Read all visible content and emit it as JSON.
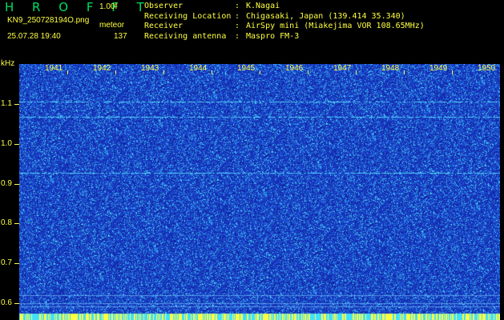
{
  "header": {
    "logo": "H R O F F T",
    "version": "1.00f",
    "filename": "KN9_250728194O.png",
    "meteor_tag": "meteor",
    "datetime": "25.07.28 19:40",
    "count": "137"
  },
  "metadata": [
    {
      "key": "Observer",
      "sep": ":",
      "value": "K.Nagai"
    },
    {
      "key": "Receiving Location",
      "sep": ":",
      "value": "Chigasaki, Japan (139.414 35.340)"
    },
    {
      "key": "Receiver",
      "sep": ":",
      "value": "AirSpy mini (Miakejima VOR 108.65MHz)"
    },
    {
      "key": "Receiving antenna",
      "sep": ":",
      "value": "Maspro FM-3"
    }
  ],
  "axis": {
    "unit": "kHz",
    "y_ticks": [
      "1.1",
      "1.0",
      "0.9",
      "0.8",
      "0.7",
      "0.6"
    ],
    "x_ticks": [
      "1941",
      "1942",
      "1943",
      "1944",
      "1945",
      "1946",
      "1947",
      "1948",
      "1949",
      "1950"
    ]
  },
  "colors": {
    "background": "#000000",
    "text": "#ffff40",
    "logo": "#00e060",
    "waterfall_base": "#1530b8",
    "noise": "#40e0ff",
    "bottom_strip": "#ffff40"
  }
}
